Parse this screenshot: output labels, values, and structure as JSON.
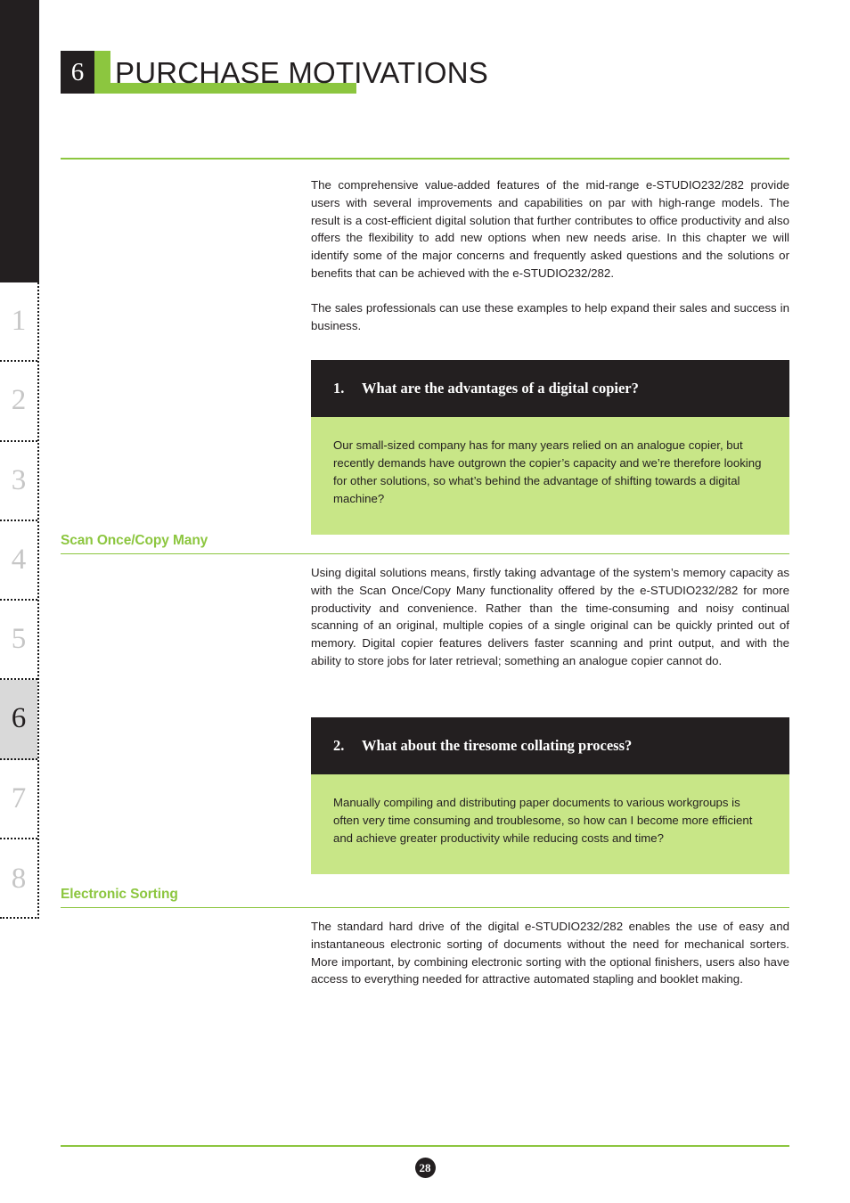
{
  "sidebar": {
    "tabs": [
      {
        "label": "1",
        "active": false
      },
      {
        "label": "2",
        "active": false
      },
      {
        "label": "3",
        "active": false
      },
      {
        "label": "4",
        "active": false
      },
      {
        "label": "5",
        "active": false
      },
      {
        "label": "6",
        "active": true
      },
      {
        "label": "7",
        "active": false
      },
      {
        "label": "8",
        "active": false
      }
    ]
  },
  "header": {
    "chapter_number": "6",
    "title": "PURCHASE MOTIVATIONS"
  },
  "intro": {
    "paragraph_1": "The comprehensive value-added features of the mid-range e-STUDIO232/282 provide users with several improvements and capabilities on par with high-range models. The result is a cost-efficient digital solution that further contributes to office productivity and also offers the flexibility to add new options when new needs arise. In this chapter we will identify some of the major concerns and frequently asked questions and the solutions or benefits that can be achieved with the e-STUDIO232/282.",
    "paragraph_2": "The sales professionals can use these examples to help expand their sales and success in business."
  },
  "qa_blocks": [
    {
      "number": "1.",
      "question": "What are the advantages of a digital copier?",
      "scenario": "Our small-sized company has for many years relied on an analogue copier, but recently demands have outgrown the copier’s capacity and we’re therefore looking for other solutions, so what’s behind the advantage of shifting towards a digital machine?"
    },
    {
      "number": "2.",
      "question": "What about the tiresome collating process?",
      "scenario": "Manually compiling and distributing paper documents to various workgroups is often very time consuming and troublesome, so how can I become more efficient and achieve greater productivity while reducing costs and time?"
    }
  ],
  "sections": [
    {
      "heading": "Scan Once/Copy Many",
      "body": "Using digital solutions means, firstly taking advantage of the system’s memory capacity as with the Scan Once/Copy Many functionality offered by the e-STUDIO232/282 for more productivity and convenience. Rather than the time-consuming and noisy continual scanning of an original, multiple copies of a single original can be quickly printed out of memory. Digital copier features delivers faster scanning and print output, and with the ability to store jobs for later retrieval; something an analogue copier cannot do."
    },
    {
      "heading": "Electronic Sorting",
      "body": "The standard hard drive of the digital e-STUDIO232/282 enables the use of easy and instantaneous electronic sorting of documents without the need for mechanical sorters. More important, by combining electronic sorting with the optional finishers, users also have access to everything needed for attractive automated stapling and booklet making."
    }
  ],
  "footer": {
    "page_number": "28"
  },
  "colors": {
    "accent_green": "#8cc63f",
    "panel_green": "#c8e687",
    "dark": "#231f20",
    "tab_inactive_text": "#c6c6c6",
    "tab_active_bg": "#d9d9d9"
  }
}
